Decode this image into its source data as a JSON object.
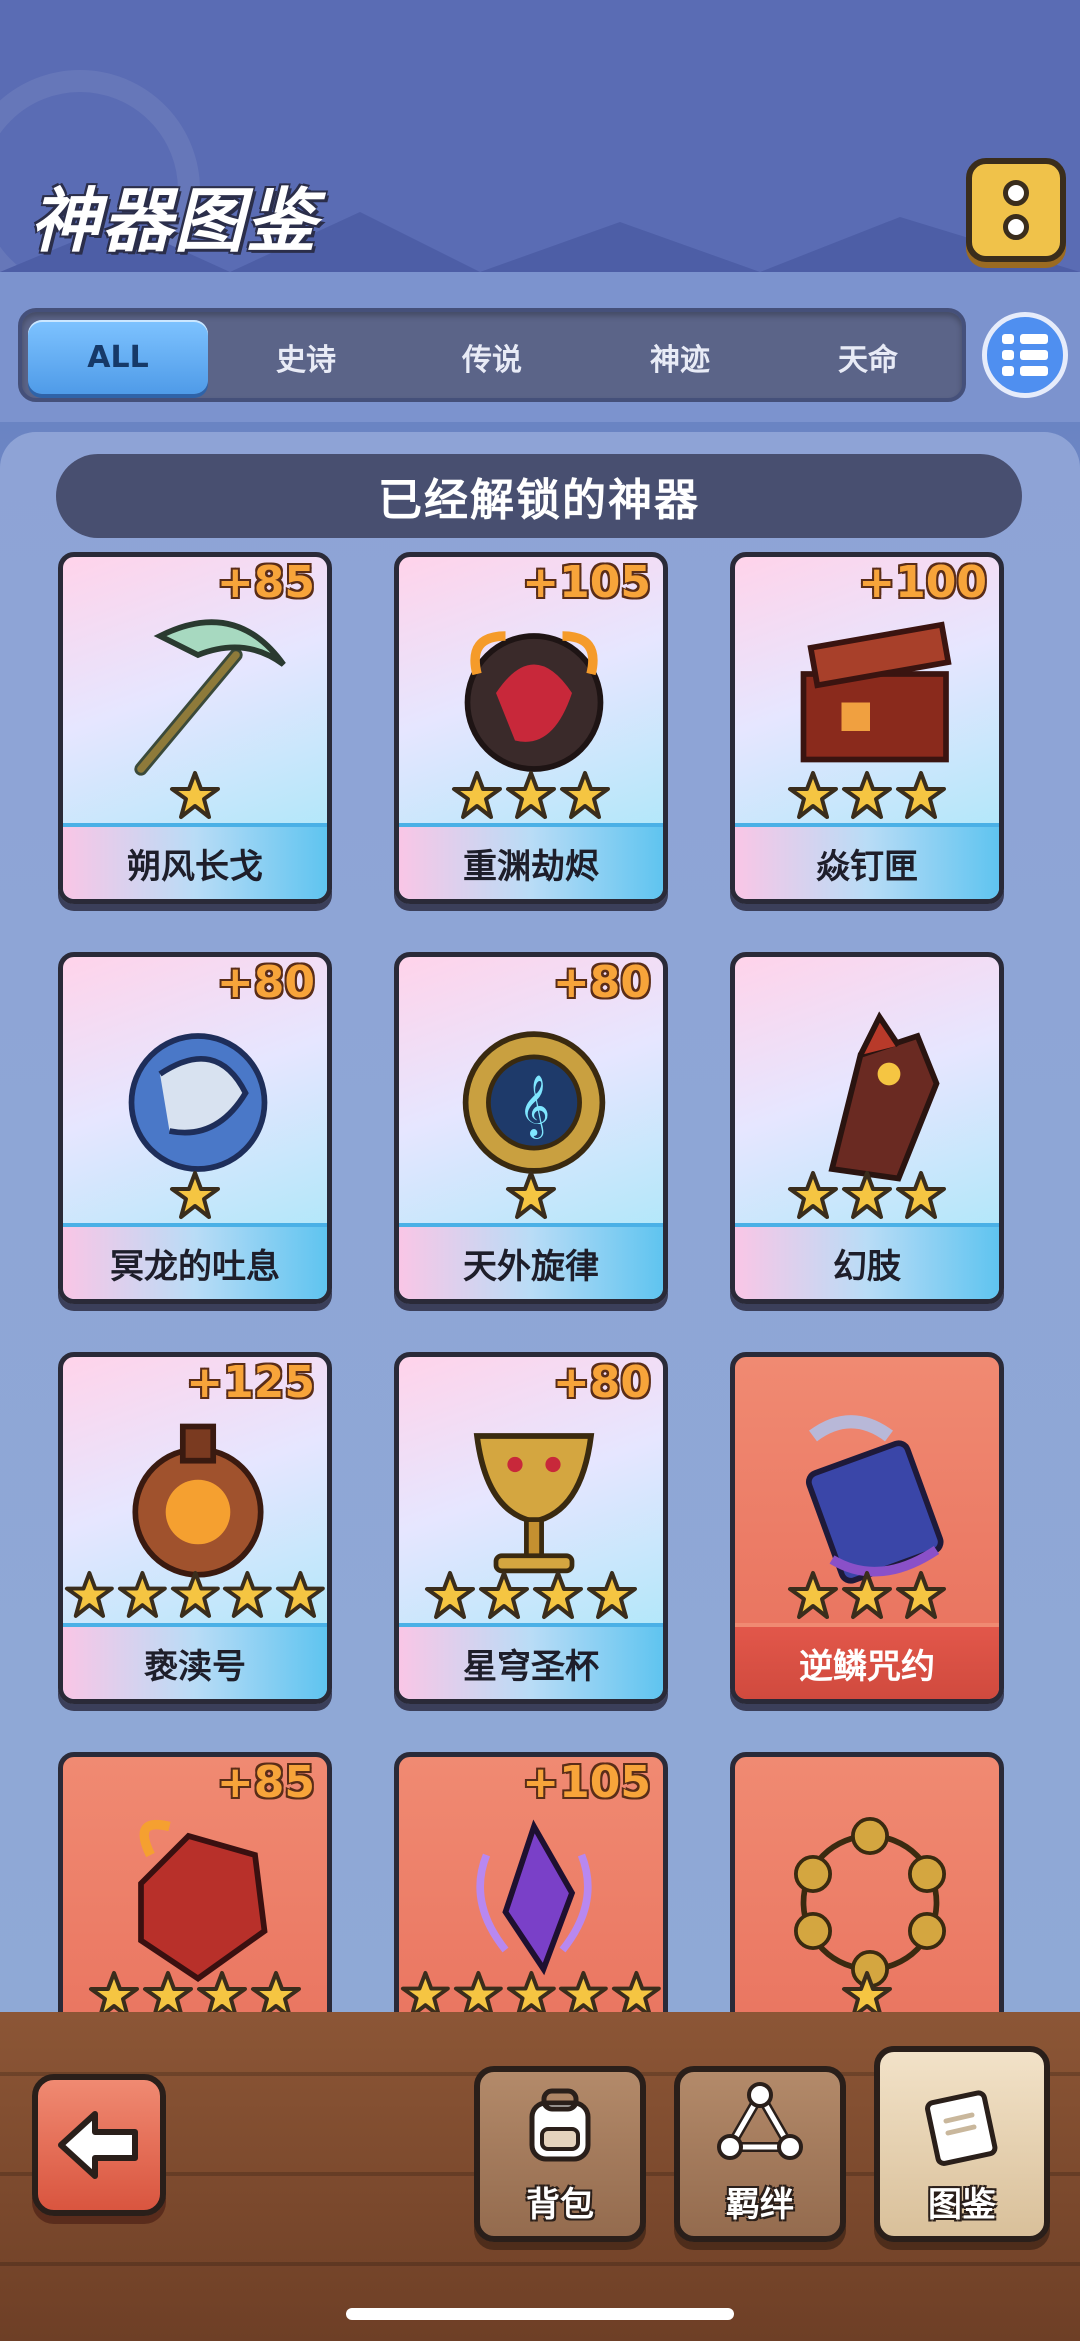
{
  "header": {
    "title": "神器图鉴"
  },
  "tabs": [
    {
      "label": "ALL",
      "active": true
    },
    {
      "label": "史诗",
      "active": false
    },
    {
      "label": "传说",
      "active": false
    },
    {
      "label": "神迹",
      "active": false
    },
    {
      "label": "天命",
      "active": false
    }
  ],
  "section": {
    "title": "已经解锁的神器"
  },
  "artifacts": [
    {
      "name": "朔风长戈",
      "bonus": "+85",
      "stars": 1,
      "rarity": "rainbow",
      "icon": "scythe-icon"
    },
    {
      "name": "重渊劫烬",
      "bonus": "+105",
      "stars": 3,
      "rarity": "rainbow",
      "icon": "flame-orb-icon"
    },
    {
      "name": "焱钉匣",
      "bonus": "+100",
      "stars": 3,
      "rarity": "rainbow",
      "icon": "chest-icon"
    },
    {
      "name": "冥龙的吐息",
      "bonus": "+80",
      "stars": 1,
      "rarity": "rainbow",
      "icon": "dragon-icon"
    },
    {
      "name": "天外旋律",
      "bonus": "+80",
      "stars": 1,
      "rarity": "rainbow",
      "icon": "music-compass-icon"
    },
    {
      "name": "幻肢",
      "bonus": "",
      "stars": 3,
      "rarity": "rainbow",
      "icon": "gauntlet-icon"
    },
    {
      "name": "亵渎号",
      "bonus": "+125",
      "stars": 5,
      "rarity": "rainbow",
      "icon": "bottle-icon"
    },
    {
      "name": "星穹圣杯",
      "bonus": "+80",
      "stars": 4,
      "rarity": "rainbow",
      "icon": "chalice-icon"
    },
    {
      "name": "逆鳞咒约",
      "bonus": "",
      "stars": 3,
      "rarity": "red",
      "icon": "scroll-icon"
    },
    {
      "name": "",
      "bonus": "+85",
      "stars": 4,
      "rarity": "red",
      "icon": "magma-rock-icon"
    },
    {
      "name": "",
      "bonus": "+105",
      "stars": 5,
      "rarity": "red",
      "icon": "void-crystal-icon"
    },
    {
      "name": "",
      "bonus": "",
      "stars": 1,
      "rarity": "red",
      "icon": "prayer-beads-icon"
    }
  ],
  "bottom_nav": {
    "back_icon": "arrow-left-icon",
    "items": [
      {
        "label": "背包",
        "icon": "backpack-icon",
        "active": false
      },
      {
        "label": "羁绊",
        "icon": "bond-icon",
        "active": false
      },
      {
        "label": "图鉴",
        "icon": "codex-icon",
        "active": true
      }
    ]
  },
  "colors": {
    "header_bg": "#5a6cb4",
    "tab_active": "#4f9be8",
    "card_red": "#e8705c",
    "star": "#f5c542",
    "bonus_text": "#f7a43a"
  }
}
